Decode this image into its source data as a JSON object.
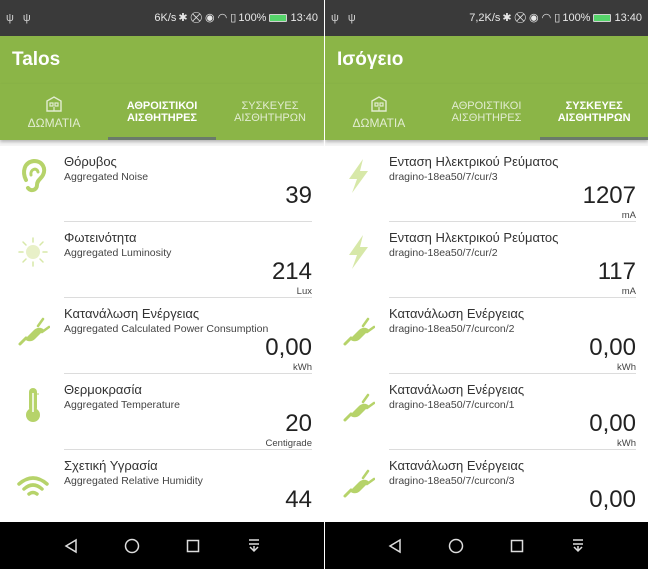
{
  "left": {
    "status": {
      "left_icons": "ψ ψ",
      "speed": "6K/s",
      "icons": "✱ ⛒ ◉ ◠ ▯",
      "battery": "100%",
      "time": "13:40"
    },
    "title": "Talos",
    "tabs": [
      {
        "label": "ΔΩΜΑΤΙΑ",
        "icon": "building-icon"
      },
      {
        "label": "ΑΘΡΟΙΣΤΙΚΟΙ ΑΙΣΘΗΤΗΡΕΣ"
      },
      {
        "label": "ΣΥΣΚΕΥΕΣ ΑΙΣΘΗΤΗΡΩΝ"
      }
    ],
    "active_tab": 1,
    "items": [
      {
        "name": "Θόρυβος",
        "subtitle": "Aggregated Noise",
        "value": "39",
        "unit": "",
        "icon": "ear-icon"
      },
      {
        "name": "Φωτεινότητα",
        "subtitle": "Aggregated Luminosity",
        "value": "214",
        "unit": "Lux",
        "icon": "sun-icon"
      },
      {
        "name": "Κατανάλωση Ενέργειας",
        "subtitle": "Aggregated Calculated Power Consumption",
        "value": "0,00",
        "unit": "kWh",
        "icon": "plug-icon"
      },
      {
        "name": "Θερμοκρασία",
        "subtitle": "Aggregated Temperature",
        "value": "20",
        "unit": "Centigrade",
        "icon": "thermometer-icon"
      },
      {
        "name": "Σχετική Υγρασία",
        "subtitle": "Aggregated Relative Humidity",
        "value": "44",
        "unit": "",
        "icon": "wifi-icon"
      }
    ]
  },
  "right": {
    "status": {
      "left_icons": "ψ ψ",
      "speed": "7,2K/s",
      "icons": "✱ ⛒ ◉ ◠ ▯",
      "battery": "100%",
      "time": "13:40"
    },
    "title": "Ισόγειο",
    "tabs": [
      {
        "label": "ΔΩΜΑΤΙΑ",
        "icon": "building-icon"
      },
      {
        "label": "ΑΘΡΟΙΣΤΙΚΟΙ ΑΙΣΘΗΤΗΡΕΣ"
      },
      {
        "label": "ΣΥΣΚΕΥΕΣ ΑΙΣΘΗΤΗΡΩΝ"
      }
    ],
    "active_tab": 2,
    "items": [
      {
        "name": "Ενταση Ηλεκτρικού Ρεύματος",
        "subtitle": "dragino-18ea50/7/cur/3",
        "value": "1207",
        "unit": "mA",
        "icon": "lightning-icon"
      },
      {
        "name": "Ενταση Ηλεκτρικού Ρεύματος",
        "subtitle": "dragino-18ea50/7/cur/2",
        "value": "117",
        "unit": "mA",
        "icon": "lightning-icon"
      },
      {
        "name": "Κατανάλωση Ενέργειας",
        "subtitle": "dragino-18ea50/7/curcon/2",
        "value": "0,00",
        "unit": "kWh",
        "icon": "plug-icon"
      },
      {
        "name": "Κατανάλωση Ενέργειας",
        "subtitle": "dragino-18ea50/7/curcon/1",
        "value": "0,00",
        "unit": "kWh",
        "icon": "plug-icon"
      },
      {
        "name": "Κατανάλωση Ενέργειας",
        "subtitle": "dragino-18ea50/7/curcon/3",
        "value": "0,00",
        "unit": "",
        "icon": "plug-icon"
      }
    ]
  },
  "colors": {
    "primary": "#8bb547",
    "icon_light": "#d7e8a8",
    "icon_mid": "#b6d36a"
  },
  "navbar": {
    "buttons": [
      "back-icon",
      "home-icon",
      "recents-icon",
      "notifications-icon"
    ]
  }
}
